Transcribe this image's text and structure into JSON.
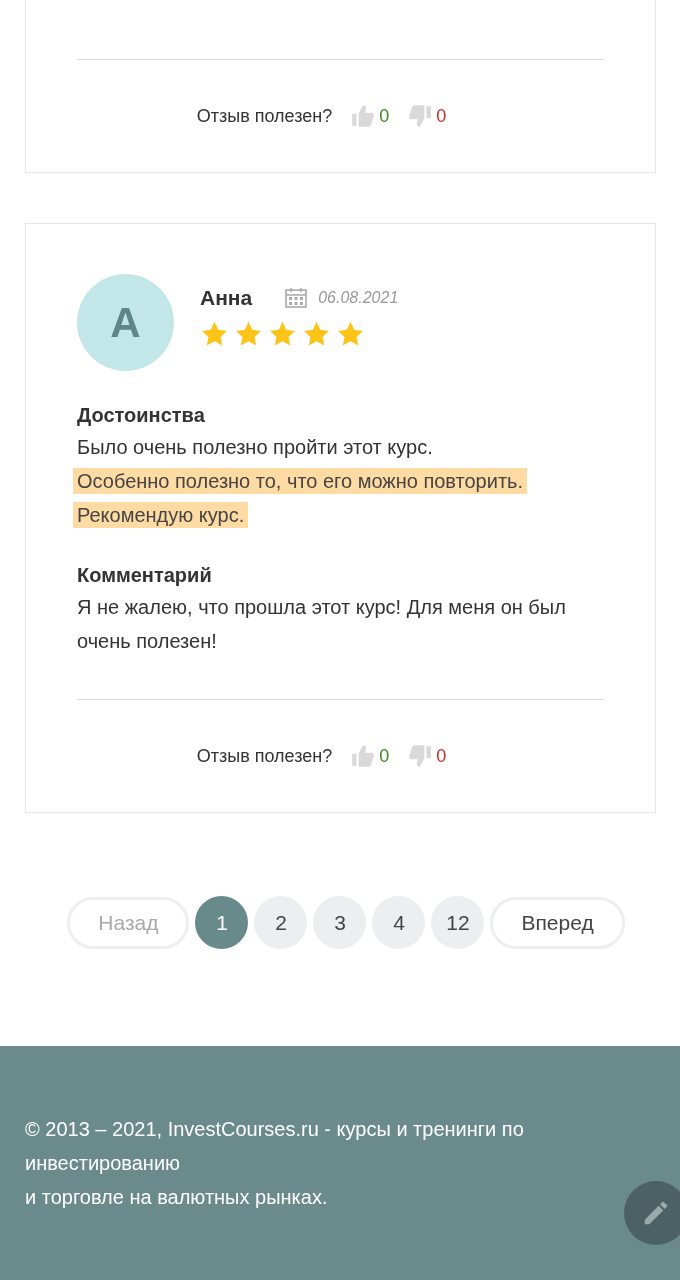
{
  "reviews": [
    {
      "partial": true,
      "votes": {
        "label": "Отзыв полезен?",
        "likes": "0",
        "dislikes": "0"
      }
    },
    {
      "partial": false,
      "author": "Анна",
      "avatar_letter": "А",
      "date": "06.08.2021",
      "stars": 5,
      "sections": [
        {
          "heading": "Достоинства",
          "lines": [
            {
              "text": "Было очень полезно пройти этот курс.",
              "marked": false
            },
            {
              "text": "Особенно полезно то, что его можно повторить.",
              "marked": true
            },
            {
              "text": "Рекомендую курс.",
              "marked": true
            }
          ]
        },
        {
          "heading": "Комментарий",
          "lines": [
            {
              "text": "Я не жалею, что прошла этот курс! Для меня он был очень полезен!",
              "marked": false
            }
          ]
        }
      ],
      "votes": {
        "label": "Отзыв полезен?",
        "likes": "0",
        "dislikes": "0"
      }
    }
  ],
  "pagination": {
    "prev": {
      "label": "Назад",
      "disabled": true
    },
    "pages": [
      {
        "label": "1",
        "selected": true
      },
      {
        "label": "2",
        "selected": false
      },
      {
        "label": "3",
        "selected": false
      },
      {
        "label": "4",
        "selected": false
      },
      {
        "label": "12",
        "selected": false
      }
    ],
    "next": {
      "label": "Вперед",
      "disabled": false
    }
  },
  "footer": {
    "lines": [
      "© 2013 – 2021, InvestCourses.ru - курсы и тренинги по инвестированию",
      "и торговле на валютных рынках."
    ]
  }
}
